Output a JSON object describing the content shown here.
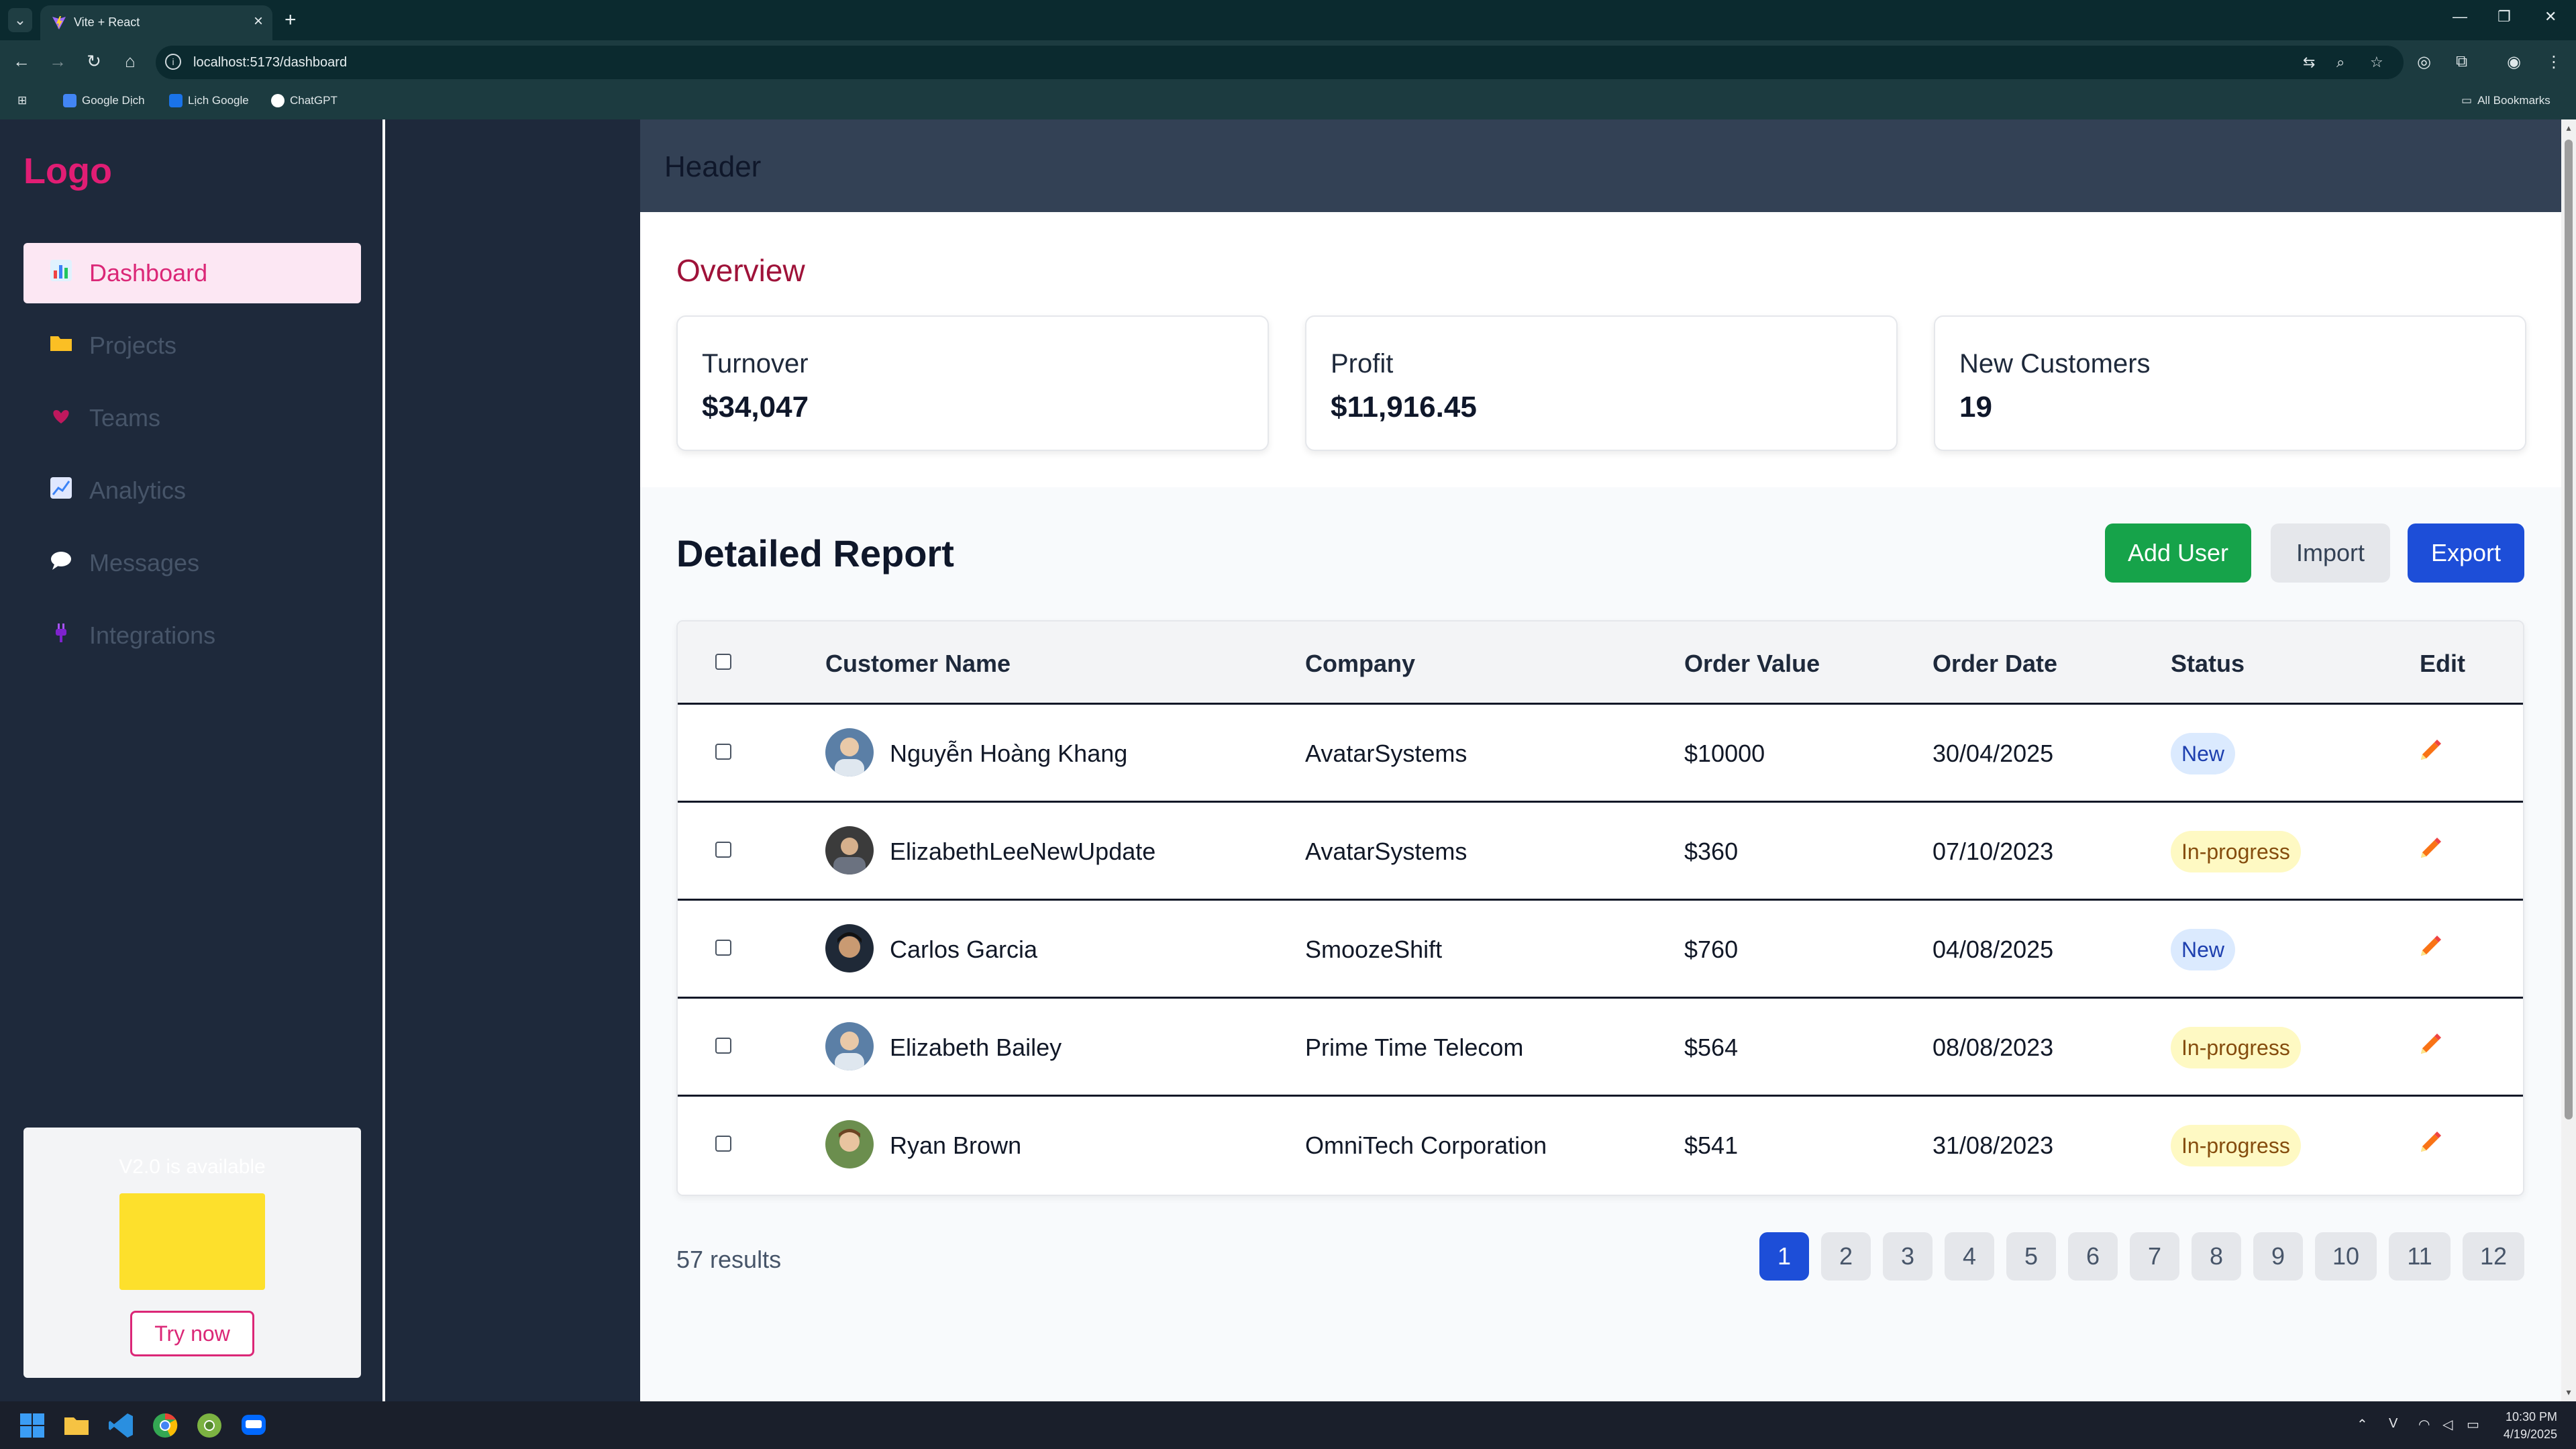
{
  "browser": {
    "tab_title": "Vite + React",
    "url": "localhost:5173/dashboard",
    "bookmarks": [
      "Google Dịch",
      "Lịch Google",
      "ChatGPT"
    ],
    "all_bookmarks": "All Bookmarks"
  },
  "sidebar": {
    "logo": "Logo",
    "items": [
      {
        "label": "Dashboard",
        "icon": "bar-chart-icon",
        "active": true
      },
      {
        "label": "Projects",
        "icon": "folder-icon"
      },
      {
        "label": "Teams",
        "icon": "heart-icon"
      },
      {
        "label": "Analytics",
        "icon": "line-chart-icon"
      },
      {
        "label": "Messages",
        "icon": "chat-bubble-icon"
      },
      {
        "label": "Integrations",
        "icon": "plug-icon"
      }
    ],
    "promo": {
      "text": "V2.0 is available",
      "button": "Try now"
    }
  },
  "header": {
    "title": "Header"
  },
  "overview": {
    "title": "Overview",
    "cards": [
      {
        "label": "Turnover",
        "value": "$34,047"
      },
      {
        "label": "Profit",
        "value": "$11,916.45"
      },
      {
        "label": "New Customers",
        "value": "19"
      }
    ]
  },
  "report": {
    "title": "Detailed Report",
    "buttons": {
      "add": "Add User",
      "import": "Import",
      "export": "Export"
    },
    "columns": [
      "Customer Name",
      "Company",
      "Order Value",
      "Order Date",
      "Status",
      "Edit"
    ],
    "rows": [
      {
        "name": "Nguyễn Hoàng Khang",
        "company": "AvatarSystems",
        "value": "$10000",
        "date": "30/04/2025",
        "status": "New"
      },
      {
        "name": "ElizabethLeeNewUpdate",
        "company": "AvatarSystems",
        "value": "$360",
        "date": "07/10/2023",
        "status": "In-progress"
      },
      {
        "name": "Carlos Garcia",
        "company": "SmoozeShift",
        "value": "$760",
        "date": "04/08/2025",
        "status": "New"
      },
      {
        "name": "Elizabeth Bailey",
        "company": "Prime Time Telecom",
        "value": "$564",
        "date": "08/08/2023",
        "status": "In-progress"
      },
      {
        "name": "Ryan Brown",
        "company": "OmniTech Corporation",
        "value": "$541",
        "date": "31/08/2023",
        "status": "In-progress"
      }
    ],
    "results": "57 results",
    "pages": [
      "1",
      "2",
      "3",
      "4",
      "5",
      "6",
      "7",
      "8",
      "9",
      "10",
      "11",
      "12"
    ],
    "active_page": "1"
  },
  "taskbar": {
    "time": "10:30 PM",
    "date": "4/19/2025"
  },
  "colors": {
    "accent_pink": "#db2777",
    "primary_blue": "#1d4ed8",
    "green": "#16a34a",
    "overview_red": "#9f1239"
  }
}
